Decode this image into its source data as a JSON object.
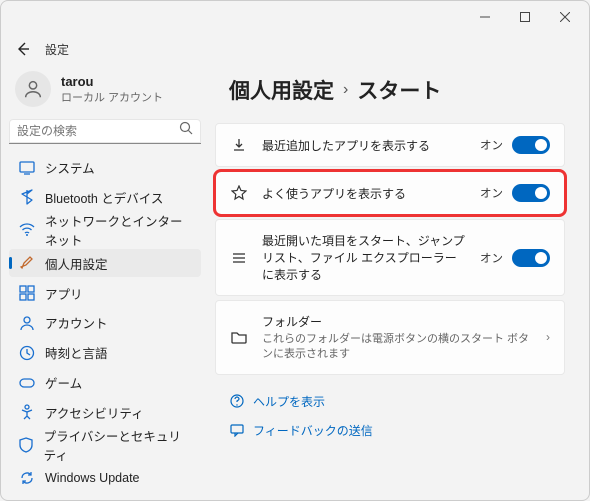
{
  "app_title": "設定",
  "user": {
    "name": "tarou",
    "desc": "ローカル アカウント"
  },
  "search": {
    "placeholder": "設定の検索"
  },
  "sidebar": {
    "items": [
      {
        "label": "システム"
      },
      {
        "label": "Bluetooth とデバイス"
      },
      {
        "label": "ネットワークとインターネット"
      },
      {
        "label": "個人用設定"
      },
      {
        "label": "アプリ"
      },
      {
        "label": "アカウント"
      },
      {
        "label": "時刻と言語"
      },
      {
        "label": "ゲーム"
      },
      {
        "label": "アクセシビリティ"
      },
      {
        "label": "プライバシーとセキュリティ"
      },
      {
        "label": "Windows Update"
      }
    ]
  },
  "breadcrumb": {
    "root": "個人用設定",
    "page": "スタート"
  },
  "settings": [
    {
      "title": "最近追加したアプリを表示する",
      "state_label": "オン"
    },
    {
      "title": "よく使うアプリを表示する",
      "state_label": "オン"
    },
    {
      "title": "最近開いた項目をスタート、ジャンプ リスト、ファイル エクスプローラーに表示する",
      "state_label": "オン"
    },
    {
      "title": "フォルダー",
      "desc": "これらのフォルダーは電源ボタンの横のスタート ボタンに表示されます"
    }
  ],
  "links": {
    "help": "ヘルプを表示",
    "feedback": "フィードバックの送信"
  }
}
